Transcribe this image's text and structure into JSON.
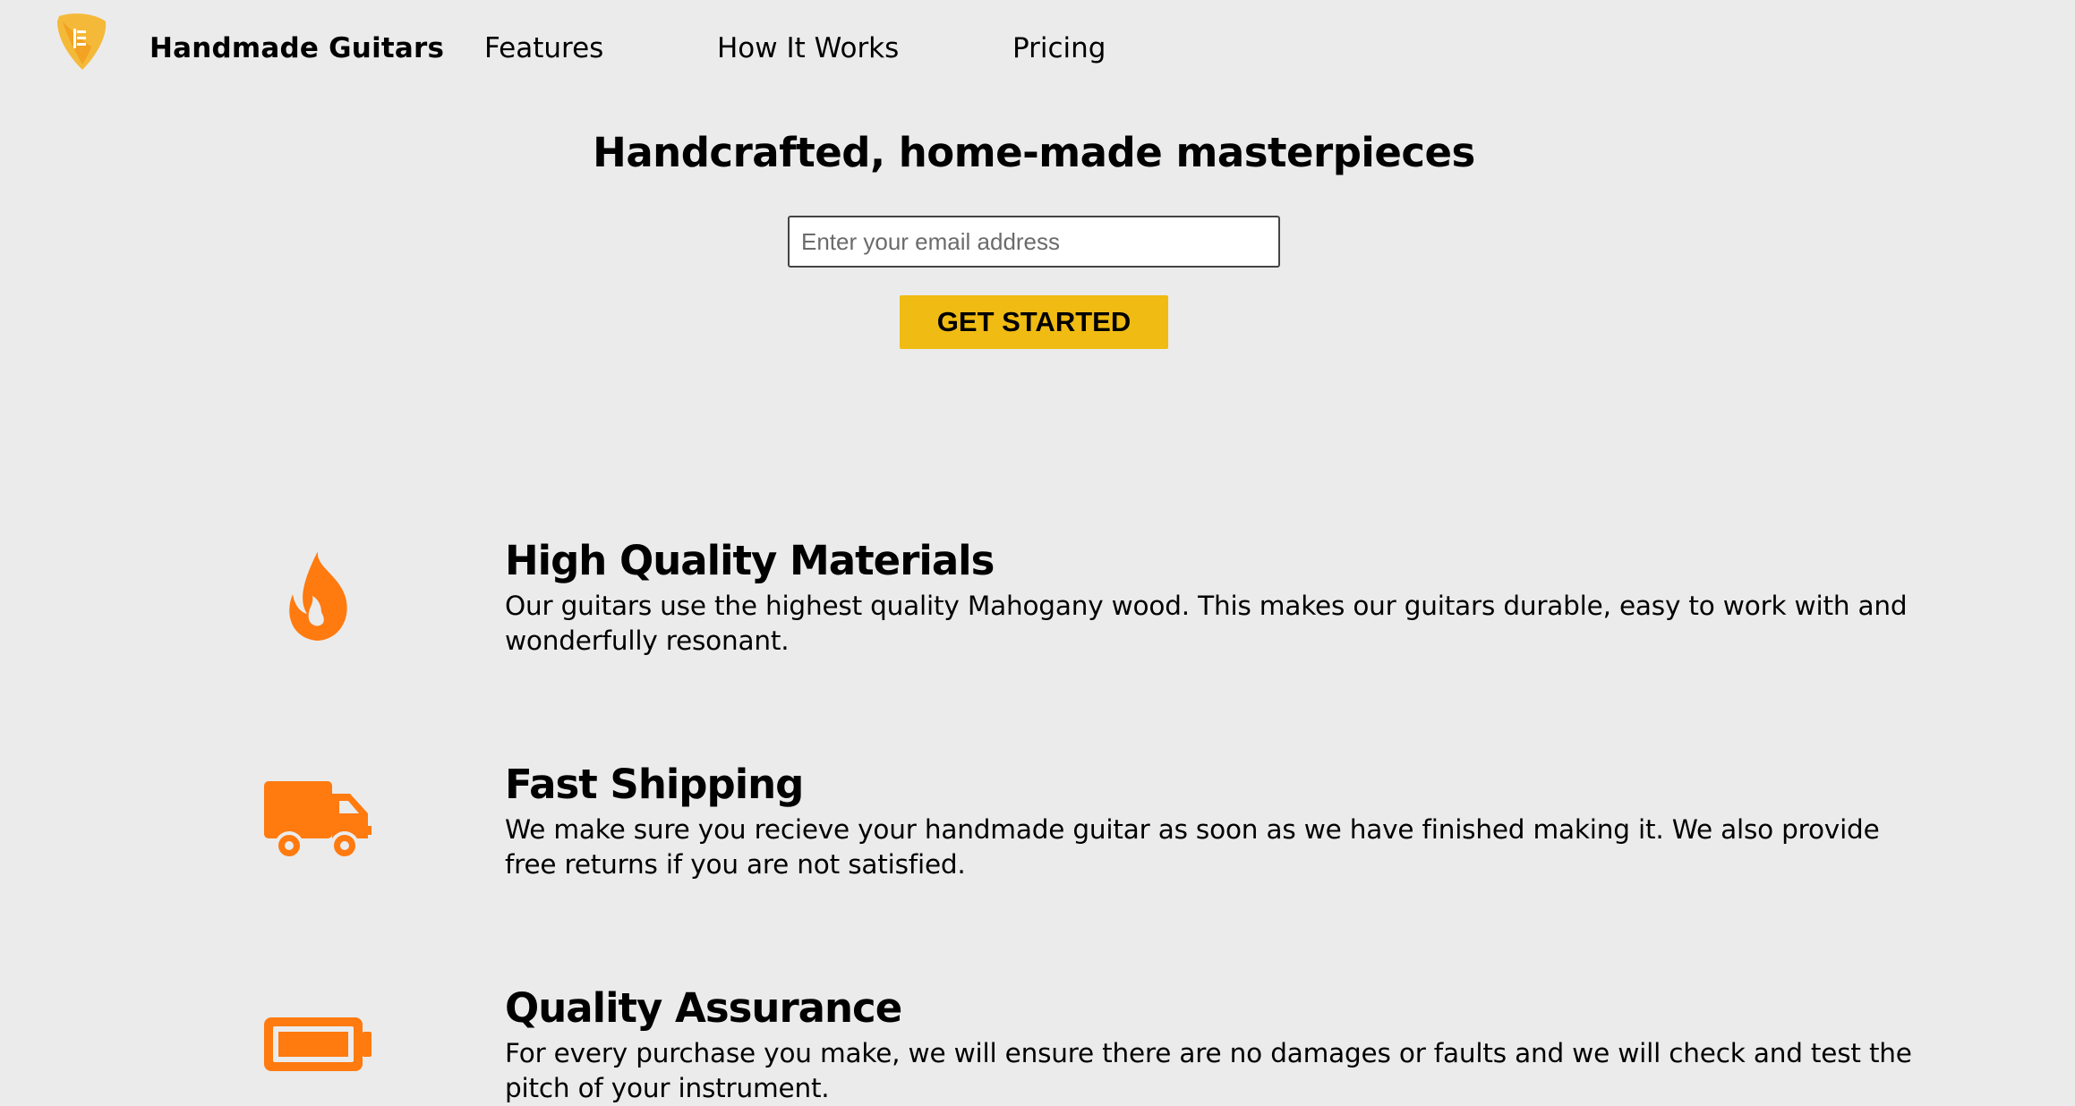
{
  "header": {
    "brand": "Handmade Guitars",
    "logo_icon": "guitar-pick-icon",
    "nav": [
      {
        "label": "Features"
      },
      {
        "label": "How It Works"
      },
      {
        "label": "Pricing"
      }
    ]
  },
  "hero": {
    "title": "Handcrafted, home-made masterpieces",
    "email_placeholder": "Enter your email address",
    "cta_label": "GET STARTED"
  },
  "features": [
    {
      "icon": "fire-icon",
      "title": "High Quality Materials",
      "description": "Our guitars use the highest quality Mahogany wood. This makes our guitars durable, easy to work with and wonderfully resonant."
    },
    {
      "icon": "truck-icon",
      "title": "Fast Shipping",
      "description": "We make sure you recieve your handmade guitar as soon as we have finished making it. We also provide free returns if you are not satisfied."
    },
    {
      "icon": "battery-full-icon",
      "title": "Quality Assurance",
      "description": "For every purchase you make, we will ensure there are no damages or faults and we will check and test the pitch of your instrument."
    }
  ],
  "colors": {
    "background": "#ebebeb",
    "accent_icon": "#ff7a0f",
    "logo": "#f5b93a",
    "cta": "#f0bb12"
  }
}
